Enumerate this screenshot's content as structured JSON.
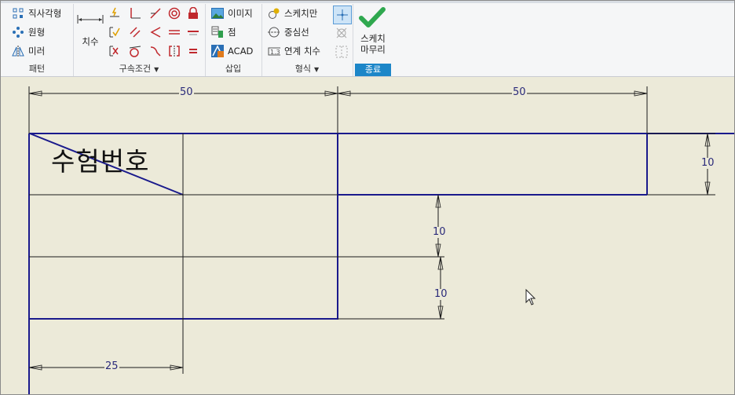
{
  "ribbon": {
    "pattern": {
      "label": "패턴",
      "items": [
        "직사각형",
        "원형",
        "미러"
      ]
    },
    "constraints": {
      "dimension_label": "치수",
      "label": "구속조건"
    },
    "insert": {
      "label": "삽입",
      "items": [
        "이미지",
        "점",
        "ACAD"
      ]
    },
    "format": {
      "label": "형식",
      "items": [
        "스케치만",
        "중심선",
        "연계 치수"
      ]
    },
    "finish": {
      "button_label_1": "스케치",
      "button_label_2": "마무리",
      "label": "종료"
    },
    "colors": {
      "accent": "#1c86c8",
      "check": "#2fa84f",
      "sketch_line": "#1a1a8c"
    }
  },
  "drawing": {
    "dims": {
      "top_left": "50",
      "top_right": "50",
      "right_height": "10",
      "mid_height_1": "10",
      "mid_height_2": "10",
      "bottom_width": "25"
    },
    "cell_text": "수험번호"
  }
}
